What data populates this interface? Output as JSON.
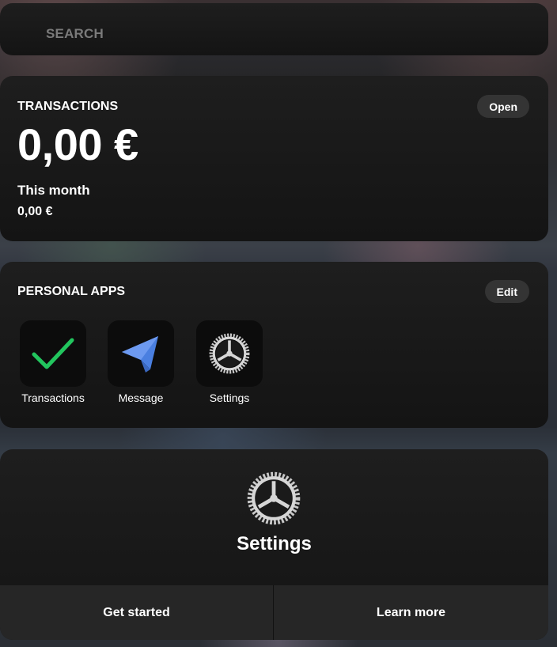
{
  "search": {
    "placeholder": "SEARCH"
  },
  "transactions": {
    "title": "TRANSACTIONS",
    "open_label": "Open",
    "total": "0,00 €",
    "period_label": "This month",
    "period_amount": "0,00 €"
  },
  "personal_apps": {
    "title": "PERSONAL APPS",
    "edit_label": "Edit",
    "apps": [
      {
        "label": "Transactions",
        "icon": "checkmark-icon",
        "color": "#22c55e"
      },
      {
        "label": "Message",
        "icon": "paper-plane-icon",
        "color": "#4a7fe0"
      },
      {
        "label": "Settings",
        "icon": "gear-icon",
        "color": "#d8d8d8"
      }
    ]
  },
  "settings_card": {
    "title": "Settings",
    "icon": "gear-icon",
    "get_started_label": "Get started",
    "learn_more_label": "Learn more"
  }
}
